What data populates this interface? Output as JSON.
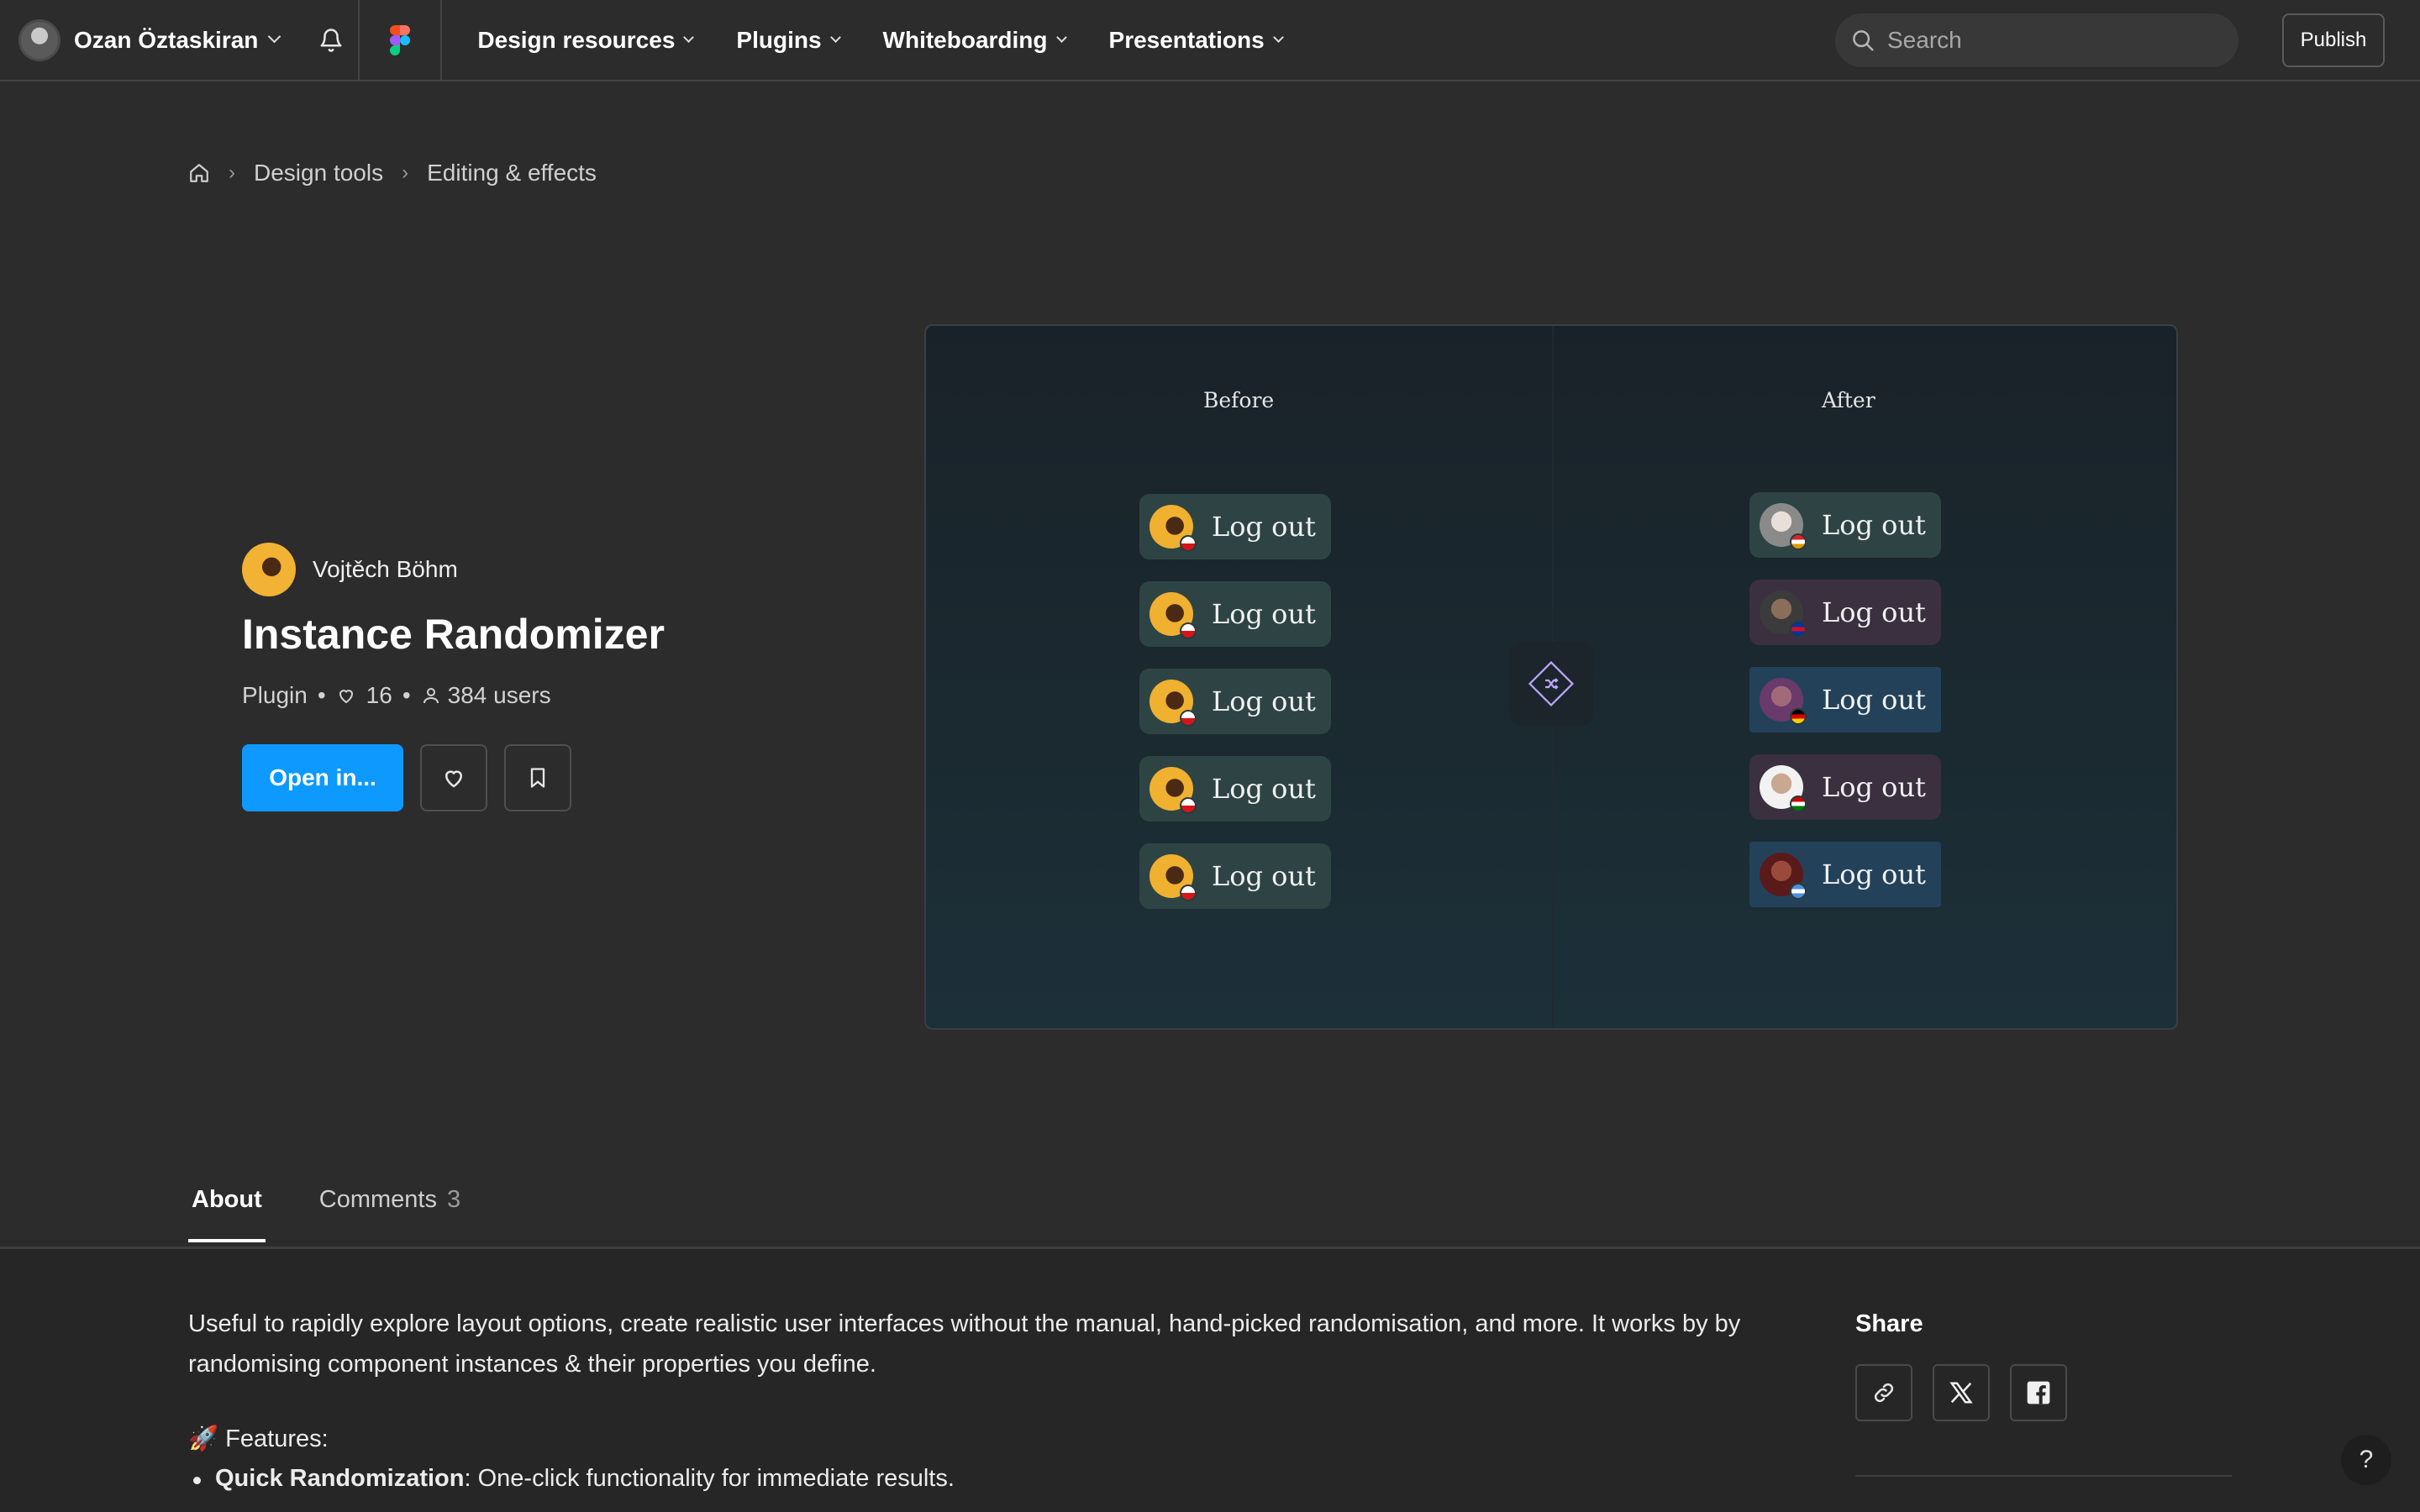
{
  "topbar": {
    "user_name": "Ozan Öztaskiran",
    "nav": [
      {
        "label": "Design resources"
      },
      {
        "label": "Plugins"
      },
      {
        "label": "Whiteboarding"
      },
      {
        "label": "Presentations"
      }
    ],
    "search_placeholder": "Search",
    "publish_label": "Publish"
  },
  "breadcrumb": {
    "items": [
      "Design tools",
      "Editing & effects"
    ]
  },
  "plugin": {
    "author": "Vojtěch Böhm",
    "title": "Instance Randomizer",
    "type": "Plugin",
    "likes": "16",
    "users": "384 users",
    "open_label": "Open in..."
  },
  "preview": {
    "before_label": "Before",
    "after_label": "After",
    "button_label": "Log out",
    "after_colors": [
      "#2e4444",
      "#3a3040",
      "#23425a",
      "#3a3040",
      "#23425a"
    ]
  },
  "tabs": {
    "about": "About",
    "comments": "Comments",
    "comments_count": "3"
  },
  "about": {
    "description": "Useful to rapidly explore layout options, create realistic user interfaces without the manual, hand-picked randomisation, and more. It works by by randomising component instances & their properties you define.",
    "features_heading": "🚀 Features:",
    "feature_1_bold": "Quick Randomization",
    "feature_1_text": ": One-click functionality for immediate results."
  },
  "share": {
    "title": "Share"
  },
  "help_label": "?"
}
